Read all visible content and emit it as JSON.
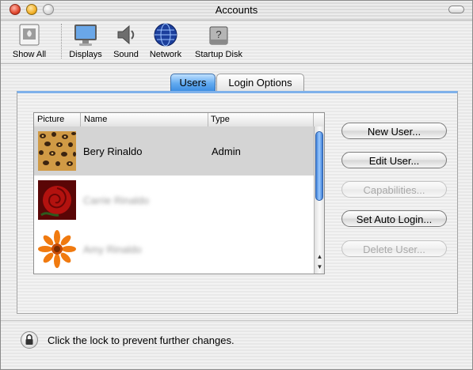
{
  "window": {
    "title": "Accounts"
  },
  "toolbar": {
    "items": [
      {
        "label": "Show All",
        "icon": "show-all-icon"
      },
      {
        "label": "Displays",
        "icon": "display-icon"
      },
      {
        "label": "Sound",
        "icon": "speaker-icon"
      },
      {
        "label": "Network",
        "icon": "globe-icon"
      },
      {
        "label": "Startup Disk",
        "icon": "disk-icon"
      }
    ]
  },
  "tabs": [
    {
      "label": "Users",
      "selected": true
    },
    {
      "label": "Login Options",
      "selected": false
    }
  ],
  "table": {
    "columns": [
      "Picture",
      "Name",
      "Type"
    ],
    "rows": [
      {
        "picture": "leopard-pattern",
        "name": "Bery Rinaldo",
        "type": "Admin",
        "selected": true
      },
      {
        "picture": "red-rose",
        "name": "Carrie Rinaldo",
        "type": "",
        "selected": false
      },
      {
        "picture": "orange-flower",
        "name": "Amy Rinaldo",
        "type": "",
        "selected": false
      }
    ]
  },
  "buttons": {
    "new_user": "New User...",
    "edit_user": "Edit User...",
    "capabilities": "Capabilities...",
    "set_auto_login": "Set Auto Login...",
    "delete_user": "Delete User..."
  },
  "footer": {
    "lock_message": "Click the lock to prevent further changes."
  },
  "colors": {
    "accent": "#3f8fe2",
    "selection": "#d4d4d4"
  }
}
